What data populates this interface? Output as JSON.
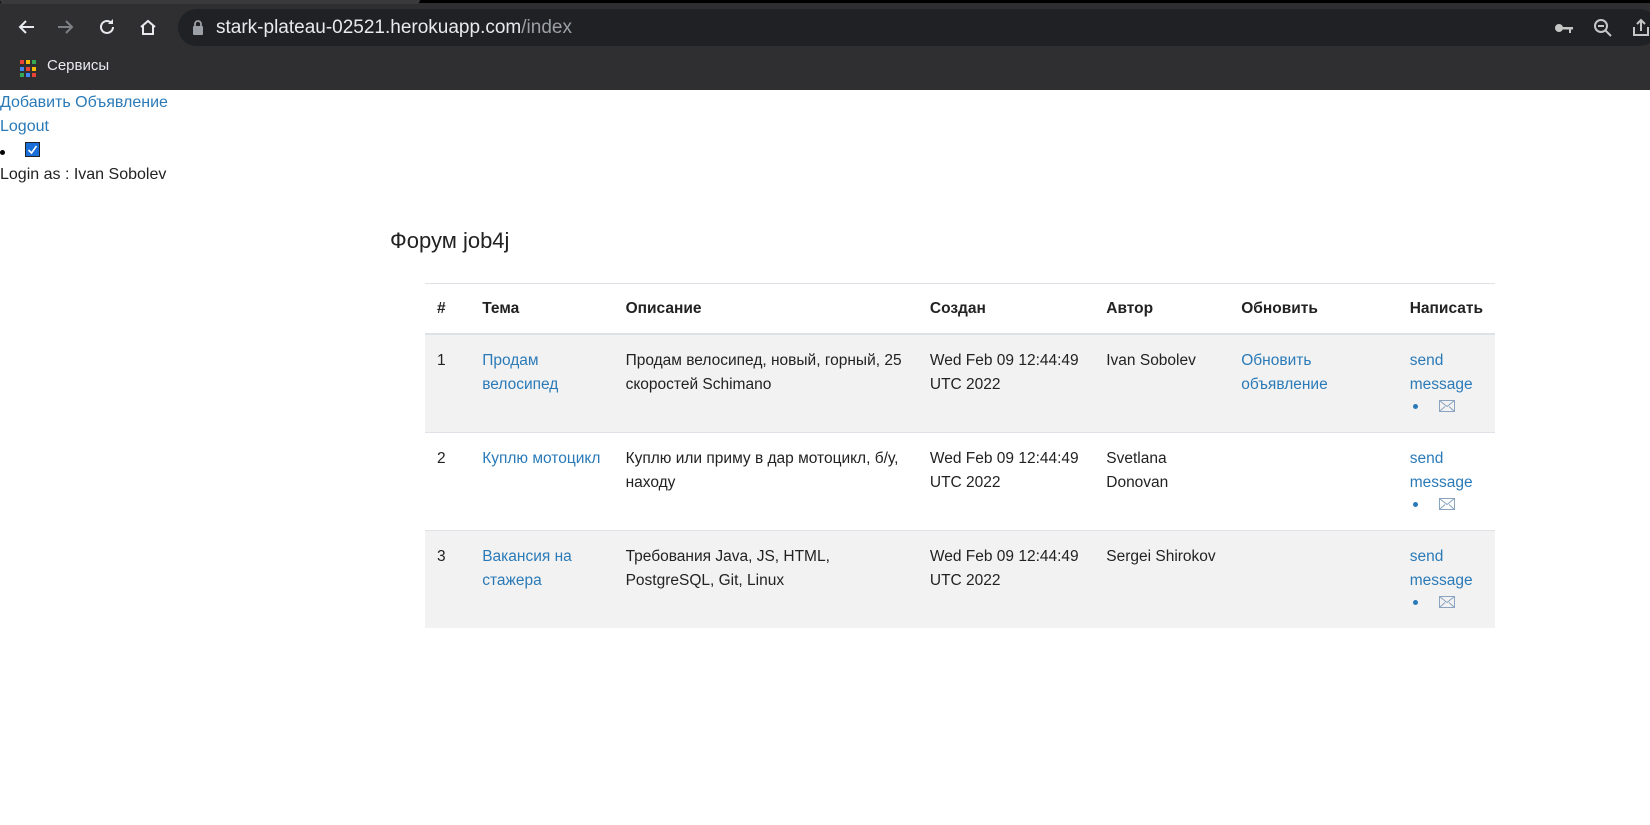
{
  "browser": {
    "url_host": "stark-plateau-02521.herokuapp.com",
    "url_path": "/index",
    "bookmark_label": "Сервисы"
  },
  "page": {
    "add_link": "Добавить Объявление",
    "logout_link": "Logout",
    "login_as": "Login as : Ivan Sobolev",
    "title": "Форум job4j"
  },
  "table": {
    "headers": [
      "#",
      "Тема",
      "Описание",
      "Создан",
      "Автор",
      "Обновить",
      "Написать"
    ],
    "rows": [
      {
        "num": "1",
        "topic": "Продам велосипед",
        "description": "Продам велосипед, новый, горный, 25 скоростей Schimano",
        "created": "Wed Feb 09 12:44:49 UTC 2022",
        "author": "Ivan Sobolev",
        "update": "Обновить объявление",
        "write": "send message"
      },
      {
        "num": "2",
        "topic": "Куплю мотоцикл",
        "description": "Куплю или приму в дар мотоцикл, б/у, находу",
        "created": "Wed Feb 09 12:44:49 UTC 2022",
        "author": "Svetlana Donovan",
        "update": "",
        "write": "send message"
      },
      {
        "num": "3",
        "topic": "Вакансия на стажера",
        "description": "Требования Java, JS, HTML, PostgreSQL, Git, Linux",
        "created": "Wed Feb 09 12:44:49 UTC 2022",
        "author": "Sergei Shirokov",
        "update": "",
        "write": "send message"
      }
    ]
  },
  "colors": {
    "link": "#2a7ab8",
    "chrome_bg": "#2f2f31",
    "omnibox_bg": "#202124",
    "row_stripe": "#f2f2f2"
  },
  "icons": [
    "back-arrow-icon",
    "forward-arrow-icon",
    "reload-icon",
    "home-icon",
    "lock-icon",
    "key-icon",
    "zoom-icon",
    "share-icon",
    "apps-grid-icon",
    "checkbox-check-icon",
    "envelope-icon"
  ]
}
